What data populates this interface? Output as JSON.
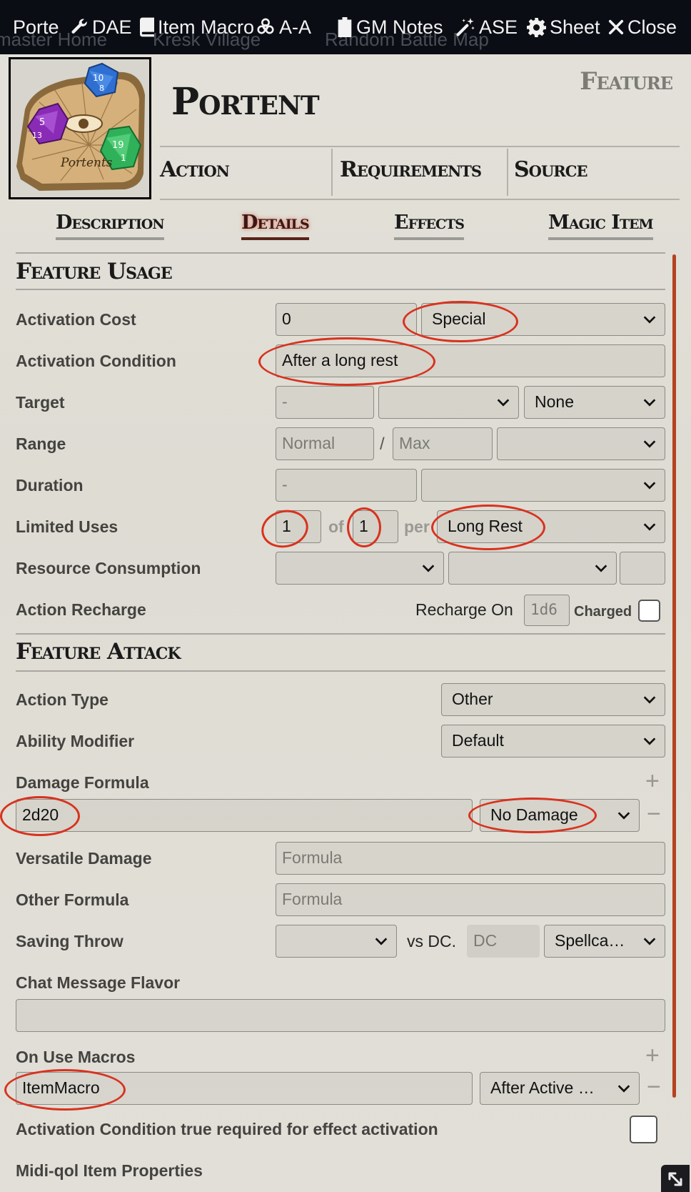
{
  "header": {
    "background_labels": [
      "master Home",
      "Kresk Village",
      "Random Battle Map"
    ],
    "buttons": [
      {
        "label": "Porte",
        "icon": ""
      },
      {
        "label": "DAE",
        "icon": "wrench-icon"
      },
      {
        "label": "Item Macro",
        "icon": "book-icon"
      },
      {
        "label": "A-A",
        "icon": "biohazard-icon"
      },
      {
        "label": "GM Notes",
        "icon": "clipboard-icon"
      },
      {
        "label": "ASE",
        "icon": "magic-wand-icon"
      },
      {
        "label": "Sheet",
        "icon": "gear-icon"
      },
      {
        "label": "Close",
        "icon": "close-icon"
      }
    ]
  },
  "item": {
    "name": "Portent",
    "type": "Feature",
    "image_caption": "Portents"
  },
  "summary": [
    "Action",
    "Requirements",
    "Source"
  ],
  "tabs": [
    "Description",
    "Details",
    "Effects",
    "Magic Item"
  ],
  "usage": {
    "heading": "Feature Usage",
    "activation_cost": {
      "label": "Activation Cost",
      "value": "0",
      "type": "Special"
    },
    "activation_condition": {
      "label": "Activation Condition",
      "value": "After a long rest"
    },
    "target": {
      "label": "Target",
      "value": "-",
      "type": "",
      "affects": "None"
    },
    "range": {
      "label": "Range",
      "normal": "Normal",
      "sep": "/",
      "max": "Max",
      "units": ""
    },
    "duration": {
      "label": "Duration",
      "value": "-",
      "units": ""
    },
    "limited_uses": {
      "label": "Limited Uses",
      "value": "1",
      "of": "of",
      "max": "1",
      "per": "per",
      "period": "Long Rest"
    },
    "resource": {
      "label": "Resource Consumption"
    },
    "recharge": {
      "label": "Action Recharge",
      "recharge_on": "Recharge On",
      "die": "1d6",
      "charged": "Charged"
    }
  },
  "attack": {
    "heading": "Feature Attack",
    "action_type": {
      "label": "Action Type",
      "value": "Other"
    },
    "ability": {
      "label": "Ability Modifier",
      "value": "Default"
    },
    "damage": {
      "label": "Damage Formula",
      "formula": "2d20",
      "type": "No Damage"
    },
    "versatile": {
      "label": "Versatile Damage",
      "placeholder": "Formula"
    },
    "other": {
      "label": "Other Formula",
      "placeholder": "Formula"
    },
    "saving": {
      "label": "Saving Throw",
      "vs": "vs DC.",
      "dc": "DC",
      "scaling": "Spellca…"
    },
    "chat_flavor": {
      "label": "Chat Message Flavor",
      "value": ""
    },
    "macros": {
      "label": "On Use Macros",
      "name": "ItemMacro",
      "when": "After Active …"
    },
    "activation_req": {
      "label": "Activation Condition true required for effect activation"
    },
    "midi_props": {
      "label": "Midi-qol Item Properties"
    }
  },
  "colors": {
    "annotation": "#d8321f",
    "scrollbar": "#b5421f",
    "header": "#0b0d15"
  }
}
